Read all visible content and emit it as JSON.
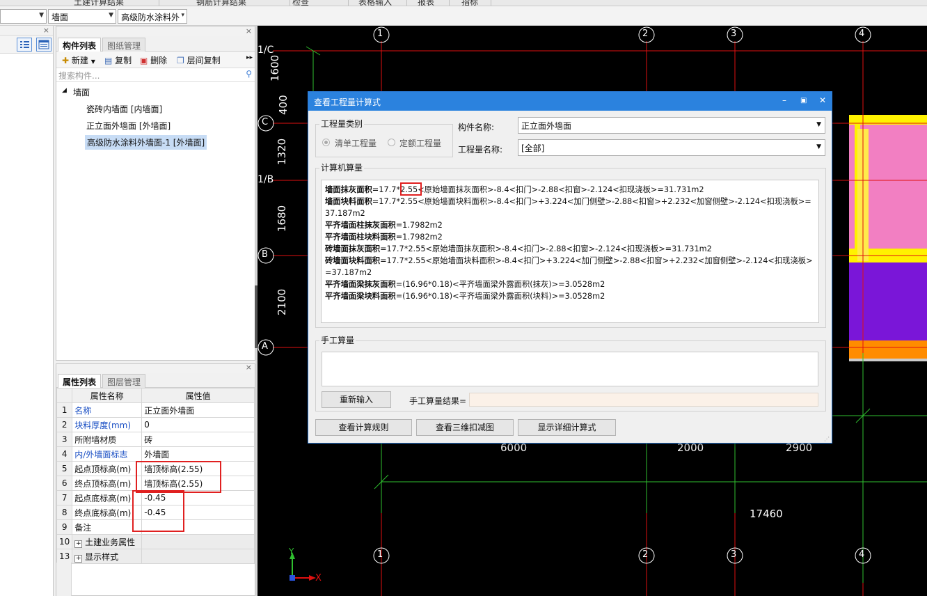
{
  "menu": {
    "items": [
      "土建计算结果",
      "钢筋计算结果",
      "检查",
      "表格输入",
      "报表",
      "指标"
    ]
  },
  "toolbar": {
    "combo1": "",
    "combo2": "墙面",
    "combo3": "高级防水涂料外"
  },
  "component_panel": {
    "tabs": [
      "构件列表",
      "图纸管理"
    ],
    "toolbar": {
      "new": "新建",
      "copy": "复制",
      "delete": "删除",
      "floor_copy": "层间复制"
    },
    "search_placeholder": "搜索构件...",
    "tree": {
      "root": "墙面",
      "items": [
        "瓷砖内墙面 [内墙面]",
        "正立面外墙面 [外墙面]",
        "高级防水涂料外墙面-1 [外墙面]"
      ]
    }
  },
  "property_panel": {
    "tabs": [
      "属性列表",
      "图层管理"
    ],
    "headers": [
      "属性名称",
      "属性值"
    ],
    "rows": [
      {
        "num": "1",
        "name": "名称",
        "value": "正立面外墙面",
        "blue": true
      },
      {
        "num": "2",
        "name": "块料厚度(mm)",
        "value": "0",
        "blue": true
      },
      {
        "num": "3",
        "name": "所附墙材质",
        "value": "砖",
        "blue": false
      },
      {
        "num": "4",
        "name": "内/外墙面标志",
        "value": "外墙面",
        "blue": true
      },
      {
        "num": "5",
        "name": "起点顶标高(m)",
        "value": "墙顶标高(2.55)",
        "blue": false
      },
      {
        "num": "6",
        "name": "终点顶标高(m)",
        "value": "墙顶标高(2.55)",
        "blue": false
      },
      {
        "num": "7",
        "name": "起点底标高(m)",
        "value": "-0.45",
        "blue": false
      },
      {
        "num": "8",
        "name": "终点底标高(m)",
        "value": "-0.45",
        "blue": false
      },
      {
        "num": "9",
        "name": "备注",
        "value": "",
        "blue": false
      },
      {
        "num": "10",
        "name": "土建业务属性",
        "value": "",
        "blue": false,
        "expand": true
      },
      {
        "num": "13",
        "name": "显示样式",
        "value": "",
        "blue": false,
        "expand": true
      }
    ]
  },
  "canvas": {
    "axis_top": [
      "1",
      "2",
      "3",
      "4"
    ],
    "axis_bottom": [
      "1",
      "2",
      "3",
      "4"
    ],
    "axis_left": [
      "1/C",
      "C",
      "1/B",
      "B",
      "A"
    ],
    "dims_left": [
      "1600",
      "400",
      "1320",
      "1680",
      "2100"
    ],
    "dims_bottom": [
      "6000",
      "2000",
      "2900"
    ],
    "total_dim": "17460",
    "axis_x": "X",
    "axis_y": "Y",
    "colors": {
      "grid": "#e01010",
      "dim": "#2fbf2f",
      "pink": "#f27fc2",
      "yellow": "#fff200",
      "purple": "#7a16d8",
      "orange": "#ff8c00"
    }
  },
  "dialog": {
    "title": "查看工程量计算式",
    "qty_type_label": "工程量类别",
    "radio_list": "清单工程量",
    "radio_quota": "定额工程量",
    "comp_name_label": "构件名称:",
    "comp_name_value": "正立面外墙面",
    "qty_name_label": "工程量名称:",
    "qty_name_value": "[全部]",
    "computer_calc_label": "计算机算量",
    "calc_lines": [
      {
        "bold": "墙面抹灰面积",
        "text": "=17.7*2.55<原始墙面抹灰面积>-8.4<扣门>-2.88<扣窗>-2.124<扣现浇板>=31.731m2"
      },
      {
        "bold": "墙面块料面积",
        "text": "=17.7*2.55<原始墙面块料面积>-8.4<扣门>+3.224<加门侧壁>-2.88<扣窗>+2.232<加窗侧壁>-2.124<扣现浇板>=37.187m2"
      },
      {
        "bold": "平齐墙面柱抹灰面积",
        "text": "=1.7982m2"
      },
      {
        "bold": "平齐墙面柱块料面积",
        "text": "=1.7982m2"
      },
      {
        "bold": "砖墙面抹灰面积",
        "text": "=17.7*2.55<原始墙面抹灰面积>-8.4<扣门>-2.88<扣窗>-2.124<扣现浇板>=31.731m2"
      },
      {
        "bold": "砖墙面块料面积",
        "text": "=17.7*2.55<原始墙面块料面积>-8.4<扣门>+3.224<加门侧壁>-2.88<扣窗>+2.232<加窗侧壁>-2.124<扣现浇板>=37.187m2"
      },
      {
        "bold": "平齐墙面梁抹灰面积",
        "text": "=(16.96*0.18)<平齐墙面梁外露面积(抹灰)>=3.0528m2"
      },
      {
        "bold": "平齐墙面梁块料面积",
        "text": "=(16.96*0.18)<平齐墙面梁外露面积(块料)>=3.0528m2"
      }
    ],
    "manual_label": "手工算量",
    "reinput_button": "重新输入",
    "manual_result_label": "手工算量结果=",
    "rules_button": "查看计算规则",
    "view3d_button": "查看三维扣减图",
    "detail_button": "显示详细计算式"
  }
}
